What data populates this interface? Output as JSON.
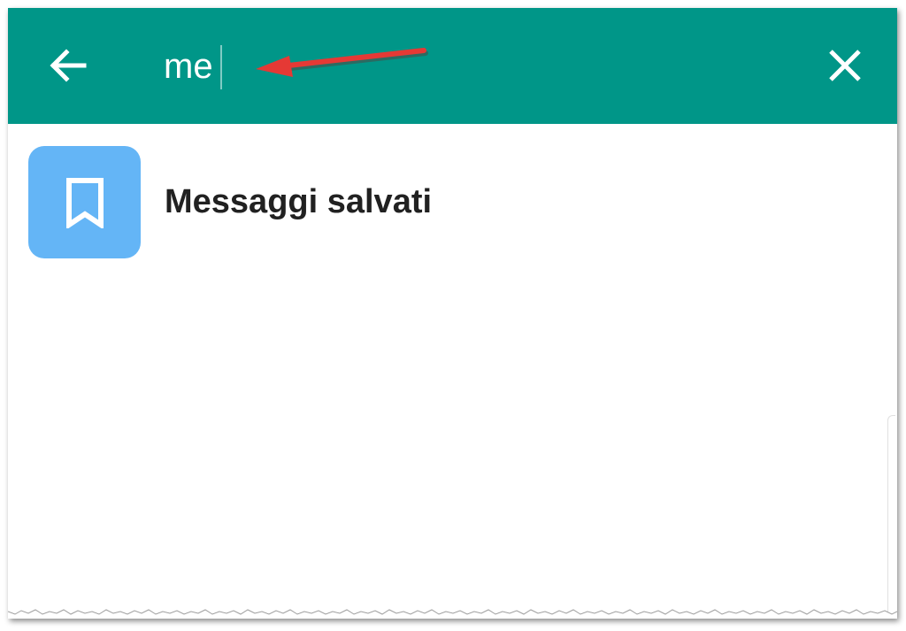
{
  "header": {
    "back_icon": "arrow-left-icon",
    "search_value": "me",
    "close_icon": "close-icon"
  },
  "results": [
    {
      "icon": "bookmark-icon",
      "title": "Messaggi salvati"
    }
  ],
  "colors": {
    "appbar": "#009688",
    "avatar": "#64b5f6",
    "annotation_arrow": "#e53935"
  }
}
